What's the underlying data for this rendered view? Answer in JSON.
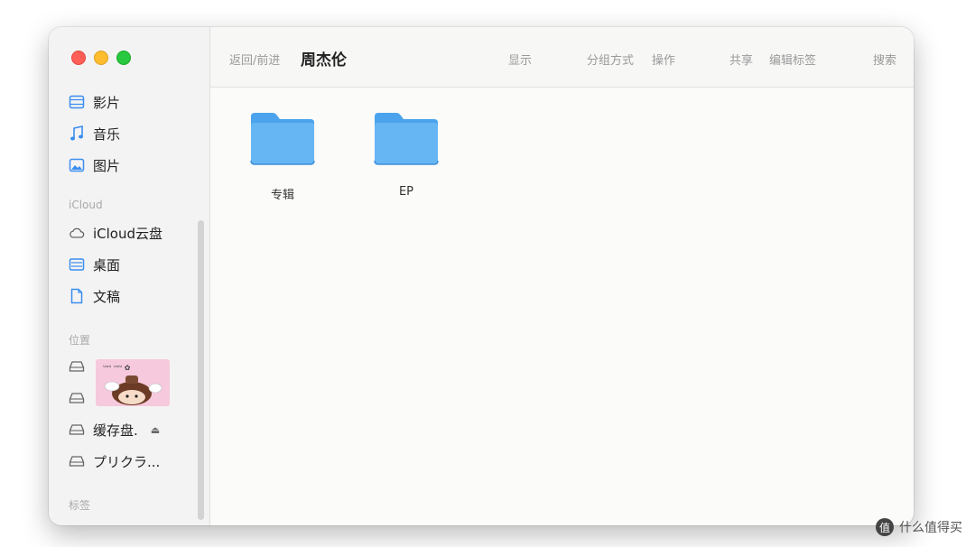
{
  "toolbar": {
    "back_forward": "返回/前进",
    "title": "周杰伦",
    "view": "显示",
    "group_by": "分组方式",
    "action": "操作",
    "share": "共享",
    "edit_tags": "编辑标签",
    "search": "搜索"
  },
  "sidebar": {
    "favorites": [
      {
        "label": "影片",
        "icon": "film-icon"
      },
      {
        "label": "音乐",
        "icon": "music-icon"
      },
      {
        "label": "图片",
        "icon": "photo-icon"
      }
    ],
    "icloud_header": "iCloud",
    "icloud": [
      {
        "label": "iCloud云盘",
        "icon": "cloud-icon"
      },
      {
        "label": "桌面",
        "icon": "desktop-icon"
      },
      {
        "label": "文稿",
        "icon": "document-icon"
      }
    ],
    "locations_header": "位置",
    "locations": [
      {
        "label": "",
        "icon": "drive-icon"
      },
      {
        "label": "",
        "icon": "drive-icon"
      },
      {
        "label": "缓存盘.",
        "icon": "drive-icon",
        "eject": "⏏"
      },
      {
        "label": "プリクラ...",
        "icon": "drive-icon"
      }
    ],
    "tags_header": "标签"
  },
  "folders": [
    {
      "label": "专辑",
      "icon": "folder-icon"
    },
    {
      "label": "EP",
      "icon": "folder-icon"
    }
  ],
  "watermark": {
    "badge": "值",
    "text": "什么值得买"
  },
  "colors": {
    "folder": "#66b6f4",
    "folder_dark": "#4aa3ec",
    "sidebar_icon": "#3a8ef0"
  }
}
